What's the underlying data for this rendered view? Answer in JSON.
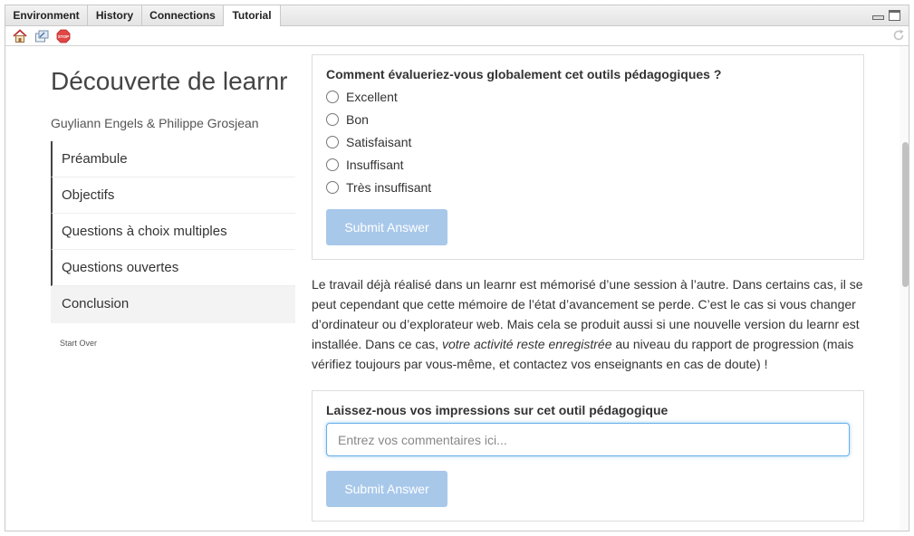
{
  "tabs": [
    {
      "label": "Environment"
    },
    {
      "label": "History"
    },
    {
      "label": "Connections"
    },
    {
      "label": "Tutorial"
    }
  ],
  "toolbar": {
    "icons": [
      "home-icon",
      "popout-icon",
      "stop-icon",
      "refresh-icon"
    ],
    "stop_label": "STOP"
  },
  "sidebar": {
    "title": "Découverte de learnr",
    "authors": "Guyliann Engels & Philippe Grosjean",
    "toc": [
      {
        "label": "Préambule"
      },
      {
        "label": "Objectifs"
      },
      {
        "label": "Questions à choix multiples"
      },
      {
        "label": "Questions ouvertes"
      },
      {
        "label": "Conclusion"
      }
    ],
    "start_over": "Start Over"
  },
  "quiz": {
    "question": "Comment évalueriez-vous globalement cet outils pédagogiques ?",
    "options": [
      "Excellent",
      "Bon",
      "Satisfaisant",
      "Insuffisant",
      "Très insuffisant"
    ],
    "submit_label": "Submit Answer"
  },
  "paragraph": {
    "text_before": "Le travail déjà réalisé dans un learnr est mémorisé d’une session à l’autre. Dans certains cas, il se peut cependant que cette mémoire de l’état d’avancement se perde. C’est le cas si vous changer d’ordinateur ou d’explorateur web. Mais cela se produit aussi si une nouvelle version du learnr est installée. Dans ce cas, ",
    "emphasis": "votre activité reste enregistrée",
    "text_after": " au niveau du rapport de progression (mais vérifiez toujours par vous-même, et contactez vos enseignants en cas de doute) !"
  },
  "feedback": {
    "question": "Laissez-nous vos impressions sur cet outil pédagogique",
    "placeholder": "Entrez vos commentaires ici...",
    "value": "",
    "submit_label": "Submit Answer"
  },
  "colors": {
    "submit_bg": "#a8c8ea",
    "input_focus": "#66afe9",
    "toc_border": "#444444"
  }
}
